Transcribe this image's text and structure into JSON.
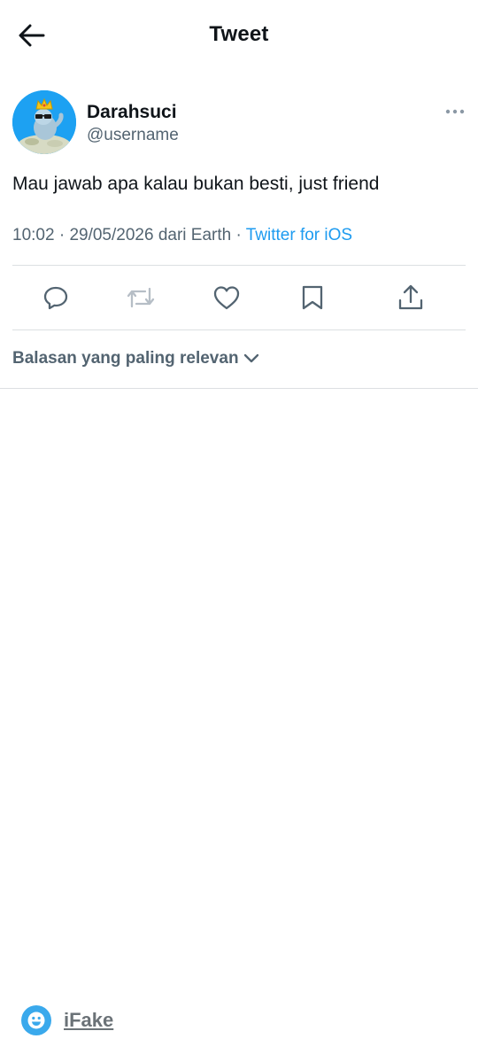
{
  "header": {
    "title": "Tweet",
    "back_icon": "arrow-left-icon"
  },
  "author": {
    "display_name": "Darahsuci",
    "username": "@username",
    "avatar_color": "#1da1f2",
    "more_icon": "more-dots-icon"
  },
  "tweet": {
    "text": "Mau jawab apa kalau bukan besti, just friend",
    "time": "10:02",
    "date": "29/05/2026",
    "location": "dari Earth",
    "source": "Twitter for iOS",
    "separator": "·"
  },
  "actions": [
    {
      "name": "reply",
      "icon": "reply-icon"
    },
    {
      "name": "retweet",
      "icon": "retweet-icon"
    },
    {
      "name": "like",
      "icon": "heart-icon"
    },
    {
      "name": "bookmark",
      "icon": "bookmark-icon"
    },
    {
      "name": "share",
      "icon": "share-icon"
    }
  ],
  "replies_sort": {
    "label": "Balasan yang paling relevan",
    "icon": "chevron-down-icon"
  },
  "watermark": {
    "label": "iFake",
    "color": "#3aa9ec"
  },
  "colors": {
    "text_primary": "#0f1419",
    "text_secondary": "#536471",
    "link": "#1d9bf0",
    "divider": "#dcdfe2"
  }
}
